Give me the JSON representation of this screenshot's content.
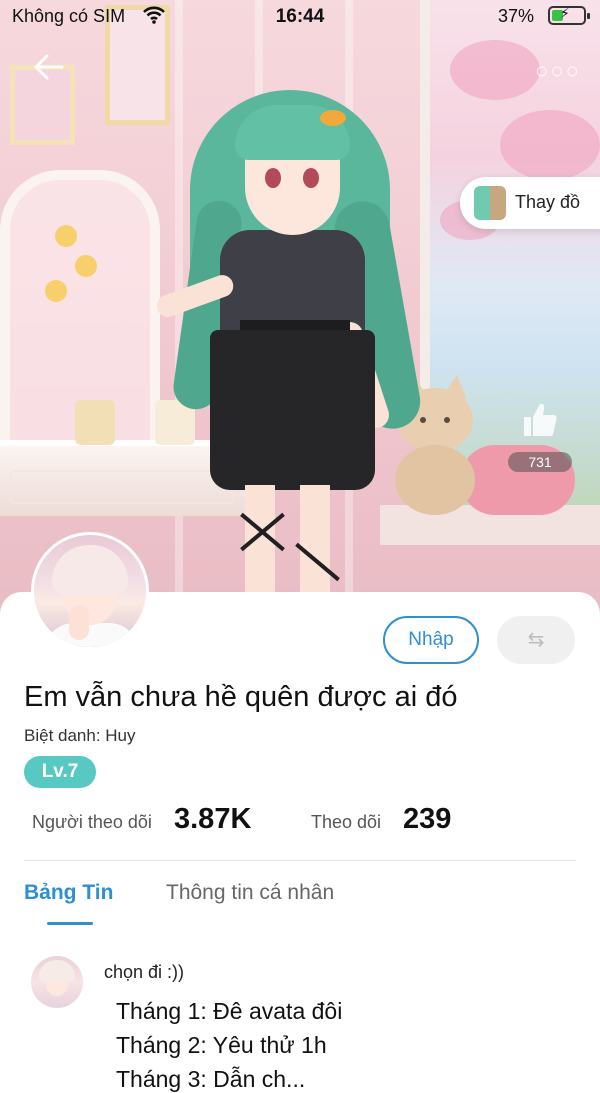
{
  "status_bar": {
    "carrier": "Không có SIM",
    "time": "16:44",
    "battery_percent": "37%",
    "battery_level": 0.37,
    "charging": true
  },
  "icons": {
    "back": "back-arrow-icon",
    "wifi": "wifi-icon",
    "battery": "battery-icon",
    "more": "more-dots-icon",
    "like": "thumbs-up-icon",
    "swap": "swap-arrows-icon"
  },
  "scene": {
    "change_outfit_label": "Thay đồ",
    "like_count": "731"
  },
  "profile": {
    "display_name": "Em vẫn chưa hề quên được ai đó",
    "nickname": "Biệt danh: Huy",
    "level": "Lv.7",
    "import_button": "Nhập",
    "swap_button": "⇆",
    "followers_label": "Người theo dõi",
    "followers_value": "3.87K",
    "following_label": "Theo dõi",
    "following_value": "239"
  },
  "tabs": [
    {
      "label": "Bảng Tin",
      "active": true
    },
    {
      "label": "Thông tin cá nhân",
      "active": false
    }
  ],
  "post": {
    "author_text": "chọn đi :))",
    "lines": [
      "Tháng 1: Đê avata đôi",
      "Tháng 2: Yêu thử 1h",
      "Tháng 3: Dẫn ch..."
    ]
  },
  "colors": {
    "accent": "#2f8fd0",
    "level_badge": "#57c8c2",
    "battery_fill": "#37c34a"
  }
}
